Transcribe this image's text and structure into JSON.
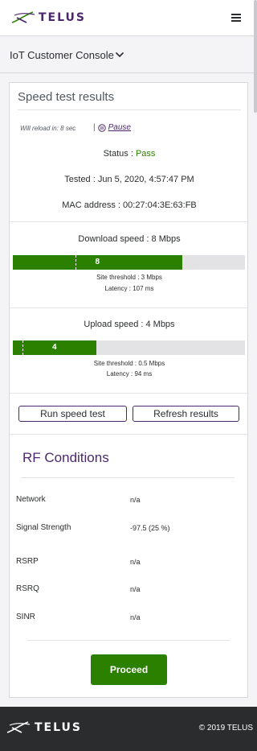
{
  "header": {
    "brand": "TELUS",
    "menu_icon": "hamburger-menu-icon"
  },
  "console": {
    "title": "IoT Customer Console",
    "chevron_icon": "chevron-down-icon"
  },
  "speed_test": {
    "title": "Speed test results",
    "reload_text": "Will reload in: 8 sec",
    "separator": "|",
    "pause_label": "Pause",
    "status_label": "Status :",
    "status_value": "Pass",
    "tested": "Tested : Jun 5, 2020, 4:57:47 PM",
    "mac": "MAC address : 00:27:04:3E:63:FB",
    "download": {
      "title": "Download speed : 8 Mbps",
      "bar_value": "8",
      "fill_fraction": 0.73,
      "threshold_fraction": 0.27,
      "threshold_text": "Site threshold : 3 Mbps",
      "latency_text": "Latency : 107 ms"
    },
    "upload": {
      "title": "Upload speed : 4 Mbps",
      "bar_value": "4",
      "fill_fraction": 0.36,
      "threshold_fraction": 0.04,
      "threshold_text": "Site threshold : 0.5 Mbps",
      "latency_text": "Latency : 94 ms"
    },
    "run_button": "Run speed test",
    "refresh_button": "Refresh results"
  },
  "rf": {
    "title": "RF Conditions",
    "rows": [
      {
        "label": "Network",
        "value": "n/a"
      },
      {
        "label": "Signal Strength",
        "value": "-97.5 (25 %)"
      },
      {
        "label": "RSRP",
        "value": "n/a"
      },
      {
        "label": "RSRQ",
        "value": "n/a"
      },
      {
        "label": "SINR",
        "value": "n/a"
      }
    ]
  },
  "proceed_button": "Proceed",
  "footer": {
    "brand": "TELUS",
    "copyright": "© 2019 TELUS"
  },
  "colors": {
    "brand_purple": "#4b286d",
    "brand_green": "#2b8000",
    "footer_bg": "#2a2c2e"
  }
}
